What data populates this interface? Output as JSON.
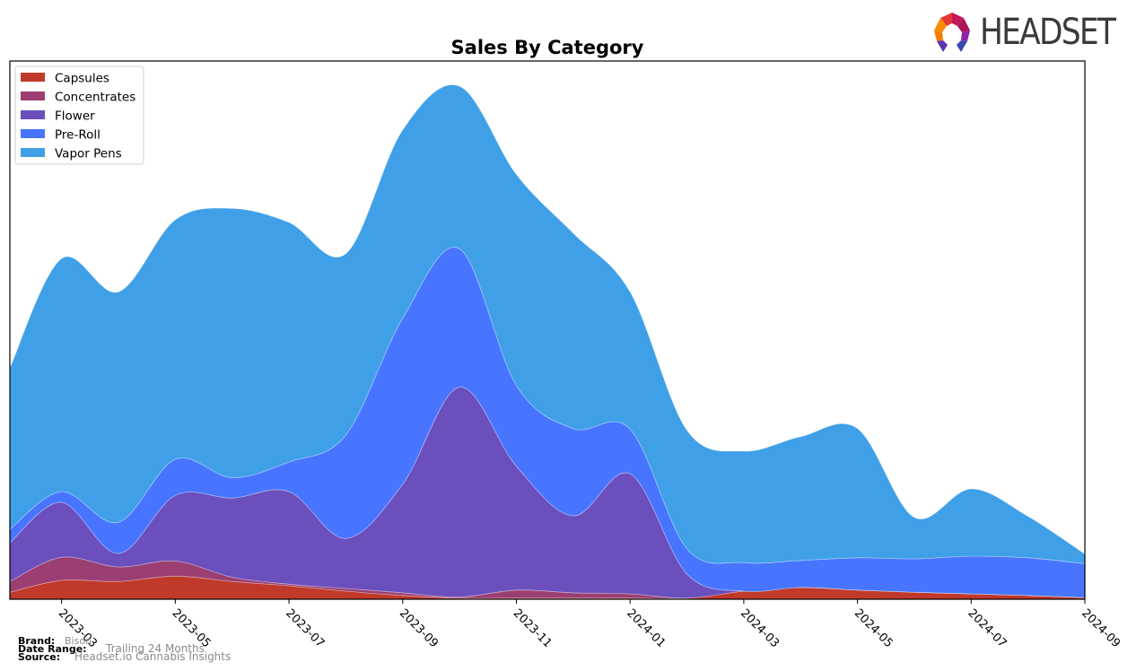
{
  "logo": {
    "text": "HEADSET",
    "colors": [
      "#c2185b",
      "#e53935",
      "#fb8c00",
      "#5e35b1",
      "#3949ab"
    ]
  },
  "footer": {
    "brand_label": "Brand:",
    "brand_value": "Bison",
    "date_range_label": "Date Range:",
    "date_range_value": "Trailing 24 Months",
    "source_label": "Source:",
    "source_value": "Headset.io Cannabis Insights"
  },
  "chart_data": {
    "type": "area",
    "stacked": true,
    "smoothed": true,
    "title": "Sales By Category",
    "xlabel": "",
    "ylabel": "",
    "y_axis_visible": false,
    "grid": false,
    "legend_position": "top-left",
    "x": [
      "2023-02",
      "2023-03",
      "2023-04",
      "2023-05",
      "2023-06",
      "2023-07",
      "2023-08",
      "2023-09",
      "2023-10",
      "2023-11",
      "2023-12",
      "2024-01",
      "2024-02",
      "2024-03",
      "2024-04",
      "2024-05",
      "2024-06",
      "2024-07",
      "2024-08",
      "2024-09"
    ],
    "x_tick_labels": [
      "2023-03",
      "2023-05",
      "2023-07",
      "2023-09",
      "2023-11",
      "2024-01",
      "2024-03",
      "2024-05",
      "2024-07",
      "2024-09"
    ],
    "y_units": "relative (percent of plot height)",
    "ylim": [
      0,
      100
    ],
    "series": [
      {
        "name": "Capsules",
        "color": "#c0392b",
        "values": [
          1.3,
          3.5,
          3.3,
          4.3,
          3.3,
          2.5,
          1.5,
          0.7,
          0.2,
          0.2,
          0.2,
          0.2,
          0.2,
          1.5,
          2.2,
          1.7,
          1.3,
          1.0,
          0.7,
          0.3
        ]
      },
      {
        "name": "Concentrates",
        "color": "#9b3f72",
        "values": [
          2.0,
          4.3,
          2.7,
          2.8,
          0.8,
          0.3,
          0.5,
          0.5,
          0.2,
          1.5,
          1.0,
          0.8,
          0.0,
          0.0,
          0.0,
          0.0,
          0.0,
          0.0,
          0.0,
          0.0
        ]
      },
      {
        "name": "Flower",
        "color": "#6a4fbd",
        "values": [
          7.2,
          10.2,
          2.5,
          12.2,
          14.7,
          17.2,
          9.3,
          20.2,
          39.0,
          23.0,
          14.3,
          22.3,
          4.5,
          0.0,
          0.0,
          0.0,
          0.0,
          0.0,
          0.0,
          0.0
        ]
      },
      {
        "name": "Pre-Roll",
        "color": "#4775ff",
        "values": [
          2.5,
          2.0,
          5.8,
          6.7,
          3.8,
          5.5,
          19.2,
          30.8,
          25.7,
          15.0,
          16.2,
          8.3,
          4.7,
          5.3,
          5.0,
          6.0,
          6.2,
          7.0,
          7.0,
          6.3
        ]
      },
      {
        "name": "Vapor Pens",
        "color": "#3fa0e8",
        "values": [
          30.0,
          43.3,
          42.8,
          44.5,
          50.0,
          44.5,
          33.7,
          35.0,
          30.2,
          39.2,
          36.3,
          25.5,
          22.0,
          20.7,
          23.0,
          24.0,
          7.7,
          12.5,
          7.7,
          1.8
        ]
      }
    ]
  }
}
